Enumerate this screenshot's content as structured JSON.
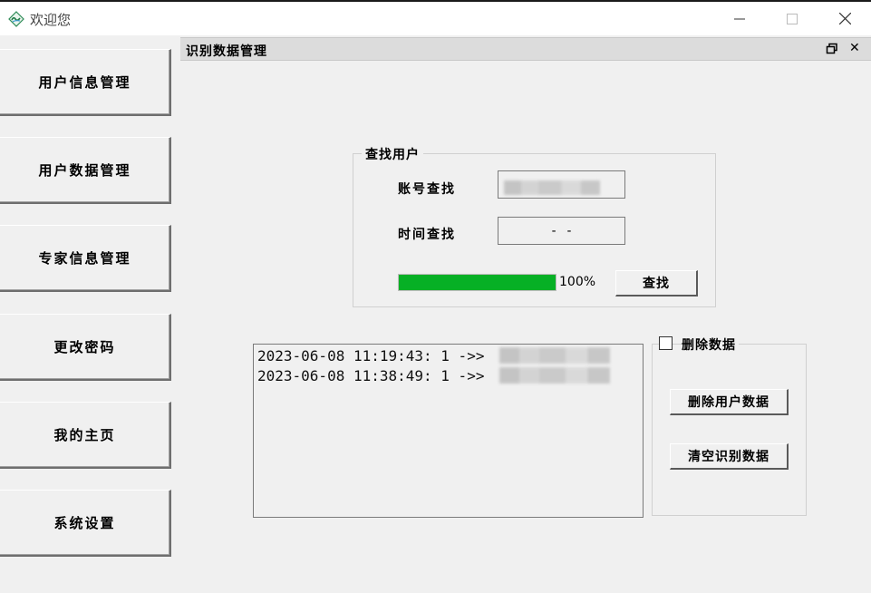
{
  "window": {
    "title": "欢迎您",
    "app_icon": "app-logo-icon",
    "controls": {
      "minimize": "minimize-icon",
      "maximize": "maximize-icon",
      "close": "close-icon"
    }
  },
  "sidebar": {
    "items": [
      {
        "label": "用户信息管理"
      },
      {
        "label": "用户数据管理"
      },
      {
        "label": "专家信息管理"
      },
      {
        "label": "更改密码"
      },
      {
        "label": "我的主页"
      },
      {
        "label": "系统设置"
      }
    ]
  },
  "child_window": {
    "title": "识别数据管理",
    "restore_icon": "restore-icon",
    "close_glyph": "✕"
  },
  "search_group": {
    "legend": "查找用户",
    "account_label": "账号查找",
    "account_value": "",
    "time_label": "时间查找",
    "time_value": "-  -",
    "progress_percent": 100,
    "progress_text": "100%",
    "search_button": "查找",
    "progress_color": "#06b025"
  },
  "log": {
    "entries": [
      {
        "text": "2023-06-08 11:19:43: 1 ->>"
      },
      {
        "text": "2023-06-08 11:38:49: 1 ->>"
      }
    ]
  },
  "delete_group": {
    "checkbox_label": "删除数据",
    "checked": false,
    "delete_user_button": "删除用户数据",
    "clear_button": "清空识别数据"
  }
}
